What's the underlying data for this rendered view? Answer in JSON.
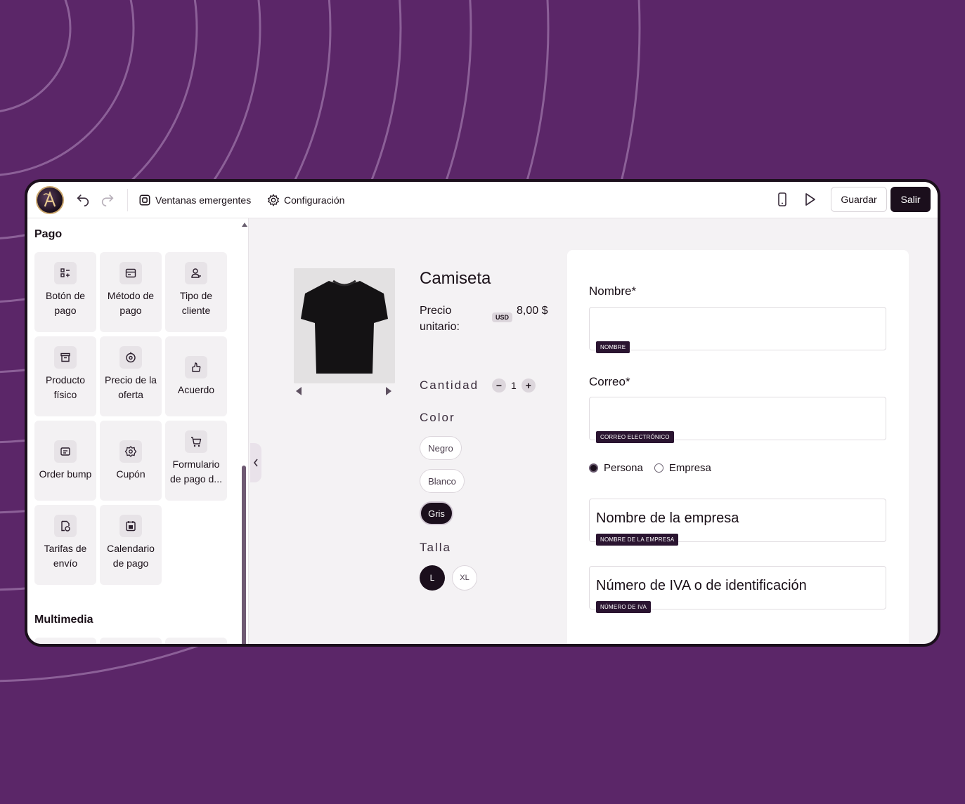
{
  "toolbar": {
    "ventanas_label": "Ventanas emergentes",
    "config_label": "Configuración",
    "save_label": "Guardar",
    "exit_label": "Salir"
  },
  "sidebar": {
    "section_pago": "Pago",
    "section_multimedia": "Multimedia",
    "items": [
      {
        "label": "Botón de pago",
        "icon": "payment-button-icon"
      },
      {
        "label": "Método de pago",
        "icon": "card-icon"
      },
      {
        "label": "Tipo de cliente",
        "icon": "user-icon"
      },
      {
        "label": "Producto físico",
        "icon": "box-icon"
      },
      {
        "label": "Precio de la oferta",
        "icon": "price-tag-icon"
      },
      {
        "label": "Acuerdo",
        "icon": "agreement-icon"
      },
      {
        "label": "Order bump",
        "icon": "order-bump-icon"
      },
      {
        "label": "Cupón",
        "icon": "coupon-icon"
      },
      {
        "label": "Formulario de pago d...",
        "icon": "cart-icon"
      },
      {
        "label": "Tarifas de envío",
        "icon": "shipping-icon"
      },
      {
        "label": "Calendario de pago",
        "icon": "calendar-icon"
      }
    ]
  },
  "product": {
    "title": "Camiseta",
    "price_label": "Precio unitario:",
    "currency_badge": "USD",
    "price": "8,00 $",
    "quantity_label": "Cantidad",
    "quantity": "1",
    "color_label": "Color",
    "colors": [
      "Negro",
      "Blanco",
      "Gris"
    ],
    "selected_color": "Gris",
    "size_label": "Talla",
    "sizes": [
      "L",
      "XL"
    ],
    "selected_size": "L"
  },
  "form": {
    "nombre_label": "Nombre*",
    "nombre_tag": "NOMBRE",
    "correo_label": "Correo*",
    "correo_tag": "CORREO ELECTRÓNICO",
    "radio_persona": "Persona",
    "radio_empresa": "Empresa",
    "selected_radio": "Persona",
    "empresa_text": "Nombre de la empresa",
    "empresa_tag": "NOMBRE DE LA EMPRESA",
    "iva_text": "Número de IVA o de identificación",
    "iva_tag": "NÚMERO DE IVA"
  },
  "colors": {
    "background": "#5b2668",
    "primary_dark": "#1b0f1c",
    "tag_bg": "#2a1430"
  }
}
